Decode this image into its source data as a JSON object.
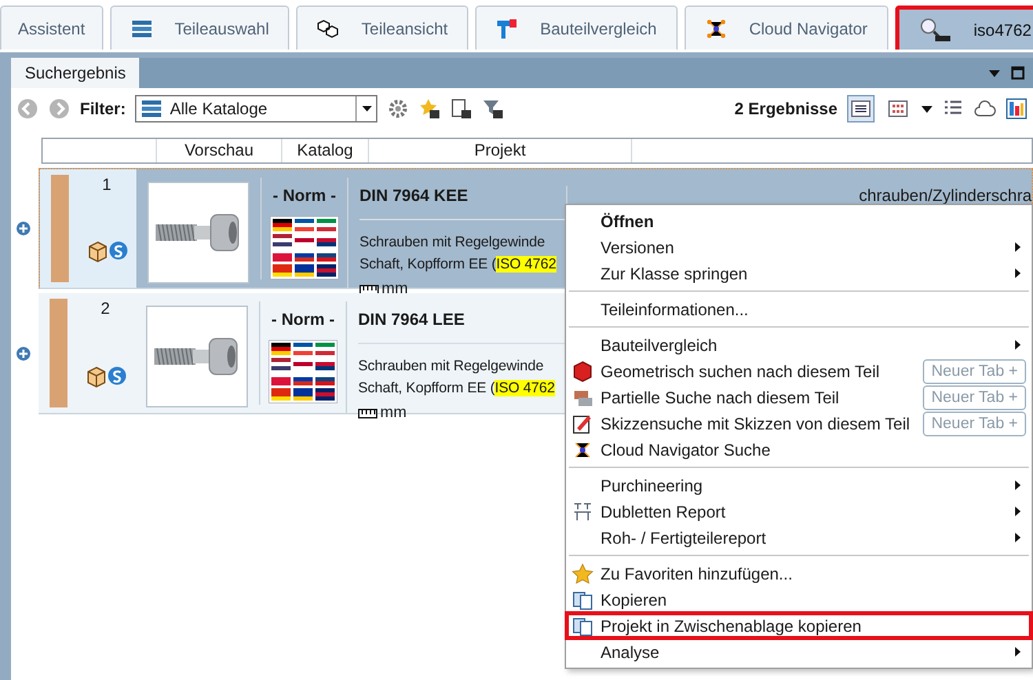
{
  "tabs": [
    {
      "label": "Assistent",
      "selected": false,
      "marked": false
    },
    {
      "label": "Teileauswahl",
      "selected": false,
      "marked": false
    },
    {
      "label": "Teileansicht",
      "selected": false,
      "marked": false
    },
    {
      "label": "Bauteilvergleich",
      "selected": false,
      "marked": false
    },
    {
      "label": "Cloud Navigator",
      "selected": false,
      "marked": false
    },
    {
      "label": "iso4762",
      "selected": true,
      "marked": true
    }
  ],
  "panel": {
    "title": "Suchergebnis"
  },
  "toolbar": {
    "filter_label": "Filter:",
    "filter_value": "Alle Kataloge",
    "result_count": "2 Ergebnisse"
  },
  "table": {
    "columns": [
      "Vorschau",
      "Katalog",
      "Projekt"
    ],
    "rows": [
      {
        "number": "1",
        "catalog": "- Norm -",
        "title": "DIN 7964 KEE",
        "description_line_1": "Schrauben mit Regelgewinde",
        "description_line_2": "Schaft, Kopfform EE (",
        "highlight": "ISO 4762",
        "unit": "mm",
        "path": "chrauben/Zylinderschra",
        "selected": true
      },
      {
        "number": "2",
        "catalog": "- Norm -",
        "title": "DIN 7964 LEE",
        "description_line_1": "Schrauben mit Regelgewinde",
        "description_line_2": "Schaft, Kopfform EE (",
        "highlight": "ISO 4762",
        "unit": "mm",
        "selected": false
      }
    ]
  },
  "context_menu": {
    "groups": [
      [
        {
          "label": "Öffnen",
          "bold": true,
          "submenu": false,
          "marked": false
        },
        {
          "label": "Versionen",
          "bold": false,
          "submenu": true,
          "marked": false
        },
        {
          "label": "Zur Klasse springen",
          "bold": false,
          "submenu": true,
          "marked": false
        }
      ],
      [
        {
          "label": "Teileinformationen...",
          "bold": false,
          "submenu": false,
          "marked": false
        }
      ],
      [
        {
          "label": "Bauteilvergleich",
          "bold": false,
          "submenu": true,
          "marked": false
        },
        {
          "label": "Geometrisch suchen nach diesem Teil",
          "bold": false,
          "submenu": false,
          "button": "Neuer Tab +",
          "marked": false
        },
        {
          "label": "Partielle Suche nach diesem Teil",
          "bold": false,
          "submenu": false,
          "button": "Neuer Tab +",
          "marked": false
        },
        {
          "label": "Skizzensuche mit Skizzen von diesem Teil",
          "bold": false,
          "submenu": false,
          "button": "Neuer Tab +",
          "marked": false
        },
        {
          "label": "Cloud Navigator Suche",
          "bold": false,
          "submenu": false,
          "marked": false
        }
      ],
      [
        {
          "label": "Purchineering",
          "bold": false,
          "submenu": true,
          "marked": false
        },
        {
          "label": "Dubletten Report",
          "bold": false,
          "submenu": true,
          "marked": false
        },
        {
          "label": "Roh- / Fertigteilereport",
          "bold": false,
          "submenu": true,
          "marked": false
        }
      ],
      [
        {
          "label": "Zu Favoriten hinzufügen...",
          "bold": false,
          "submenu": false,
          "marked": false
        },
        {
          "label": "Kopieren",
          "bold": false,
          "submenu": false,
          "marked": false
        },
        {
          "label": "Projekt in Zwischenablage kopieren",
          "bold": false,
          "submenu": false,
          "marked": true
        },
        {
          "label": "Analyse",
          "bold": false,
          "submenu": true,
          "marked": false
        }
      ]
    ]
  }
}
